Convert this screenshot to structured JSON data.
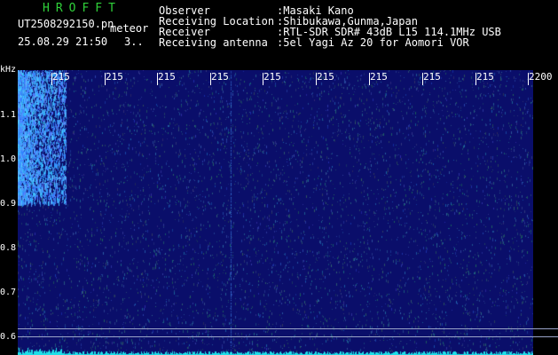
{
  "header": {
    "brand": "HROFFT",
    "filename": "UT2508292150.pn",
    "mode": "meteor",
    "datetime": "25.08.29 21:50",
    "count": "3..",
    "fields": [
      {
        "label": "Observer",
        "value": ":Masaki Kano"
      },
      {
        "label": "Receiving Location",
        "value": ":Shibukawa,Gunma,Japan"
      },
      {
        "label": "Receiver",
        "value": ":RTL-SDR SDR# 43dB L15 114.1MHz USB"
      },
      {
        "label": "Receiving antenna",
        "value": ":5el Yagi Az 20 for Aomori VOR"
      }
    ]
  },
  "spectrogram": {
    "unit_label": "kHz",
    "freq_labels": [
      "1.1",
      "1.0",
      "0.9",
      "0.8",
      "0.7",
      "0.6"
    ],
    "time_labels": [
      "215",
      "215",
      "215",
      "215",
      "215",
      "215",
      "215",
      "215",
      "215",
      "2200"
    ],
    "colors": {
      "background": "#0a0e6a",
      "signal": "#2a7bd8",
      "baseline": "#1ee0e8"
    }
  }
}
